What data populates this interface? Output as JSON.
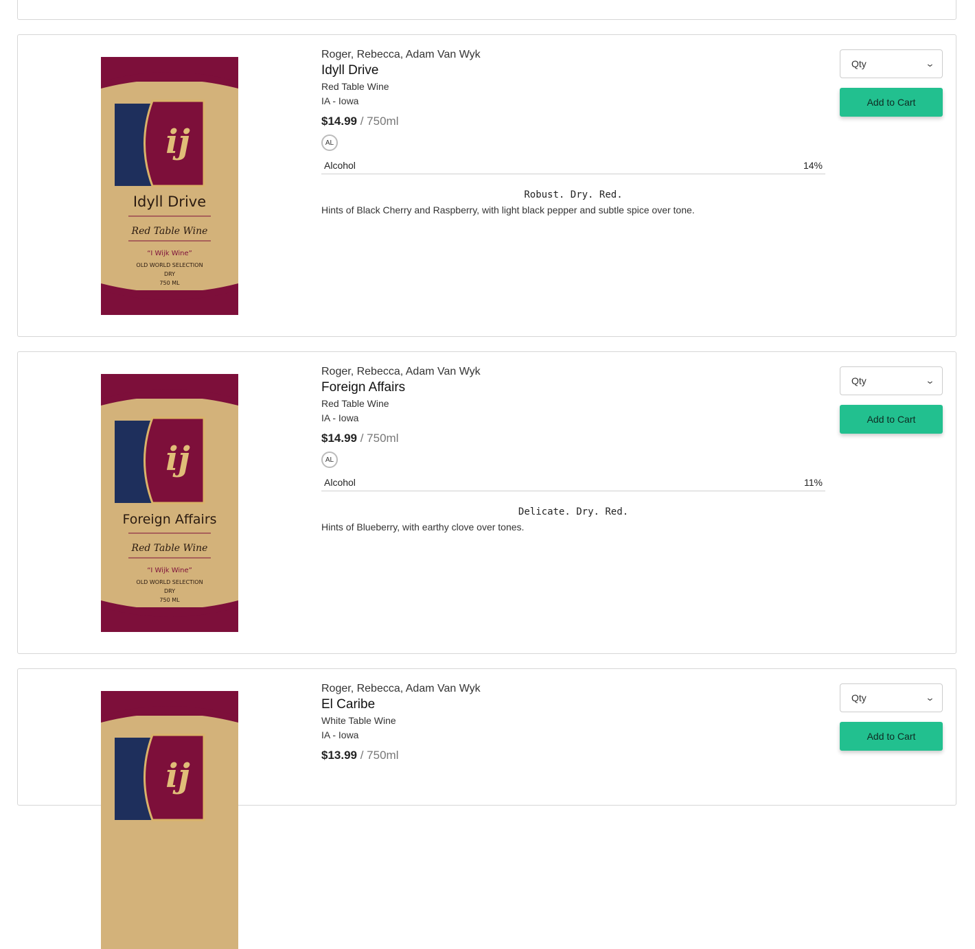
{
  "products": [
    {
      "producer": "Roger, Rebecca, Adam Van Wyk",
      "name": "Idyll Drive",
      "type": "Red Table Wine",
      "region": "IA - Iowa",
      "price": "$14.99",
      "unit": "/ 750ml",
      "badge": "AL",
      "attr_label": "Alcohol",
      "attr_value": "14%",
      "tagline": "Robust. Dry. Red.",
      "description": "Hints of Black Cherry and Raspberry, with light black pepper and subtle spice over tone.",
      "qty_placeholder": "Qty",
      "cart_label": "Add to Cart",
      "label_art": {
        "monogram": "ij",
        "title": "Idyll Drive",
        "subtitle": "Red Table Wine",
        "quote": "“I Wijk Wine”",
        "line1": "OLD WORLD SELECTION",
        "line2": "DRY",
        "line3": "750 ML"
      }
    },
    {
      "producer": "Roger, Rebecca, Adam Van Wyk",
      "name": "Foreign Affairs",
      "type": "Red Table Wine",
      "region": "IA - Iowa",
      "price": "$14.99",
      "unit": "/ 750ml",
      "badge": "AL",
      "attr_label": "Alcohol",
      "attr_value": "11%",
      "tagline": "Delicate. Dry. Red.",
      "description": "Hints of Blueberry, with earthy clove over tones.",
      "qty_placeholder": "Qty",
      "cart_label": "Add to Cart",
      "label_art": {
        "monogram": "ij",
        "title": "Foreign Affairs",
        "subtitle": "Red Table Wine",
        "quote": "“I Wijk Wine”",
        "line1": "OLD WORLD SELECTION",
        "line2": "DRY",
        "line3": "750 ML"
      }
    },
    {
      "producer": "Roger, Rebecca, Adam Van Wyk",
      "name": "El Caribe",
      "type": "White Table Wine",
      "region": "IA - Iowa",
      "price": "$13.99",
      "unit": "/ 750ml",
      "qty_placeholder": "Qty",
      "cart_label": "Add to Cart",
      "label_art": {
        "monogram": "ij"
      }
    }
  ],
  "colors": {
    "accent": "#22c08f",
    "label_maroon": "#7d0f3a",
    "label_gold": "#d6b57a",
    "label_navy": "#1e2f5c"
  }
}
